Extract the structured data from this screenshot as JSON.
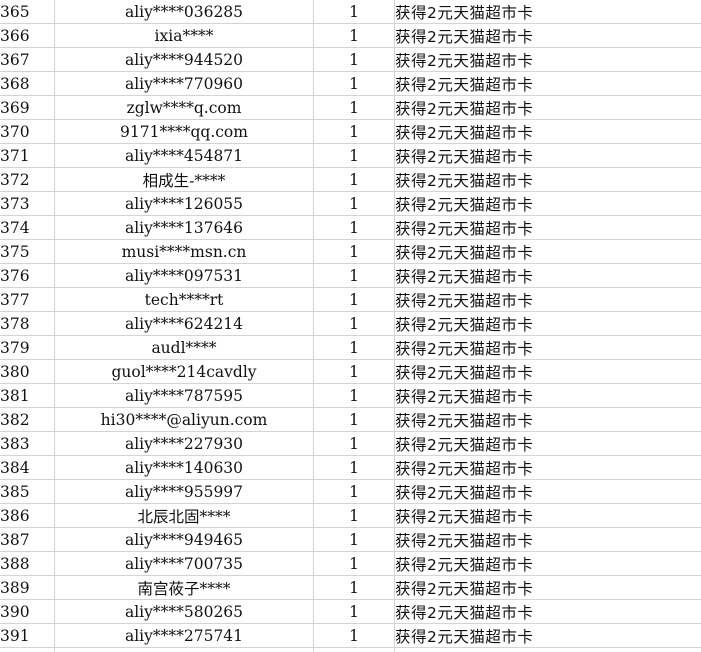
{
  "rows": [
    {
      "idx": "365",
      "user": "aliy****036285",
      "count": "1",
      "prize": "获得2元天猫超市卡"
    },
    {
      "idx": "366",
      "user": "ixia****",
      "count": "1",
      "prize": "获得2元天猫超市卡"
    },
    {
      "idx": "367",
      "user": "aliy****944520",
      "count": "1",
      "prize": "获得2元天猫超市卡"
    },
    {
      "idx": "368",
      "user": "aliy****770960",
      "count": "1",
      "prize": "获得2元天猫超市卡"
    },
    {
      "idx": "369",
      "user": "zglw****q.com",
      "count": "1",
      "prize": "获得2元天猫超市卡"
    },
    {
      "idx": "370",
      "user": "9171****qq.com",
      "count": "1",
      "prize": "获得2元天猫超市卡"
    },
    {
      "idx": "371",
      "user": "aliy****454871",
      "count": "1",
      "prize": "获得2元天猫超市卡"
    },
    {
      "idx": "372",
      "user": "相成生-****",
      "count": "1",
      "prize": "获得2元天猫超市卡"
    },
    {
      "idx": "373",
      "user": "aliy****126055",
      "count": "1",
      "prize": "获得2元天猫超市卡"
    },
    {
      "idx": "374",
      "user": "aliy****137646",
      "count": "1",
      "prize": "获得2元天猫超市卡"
    },
    {
      "idx": "375",
      "user": "musi****msn.cn",
      "count": "1",
      "prize": "获得2元天猫超市卡"
    },
    {
      "idx": "376",
      "user": "aliy****097531",
      "count": "1",
      "prize": "获得2元天猫超市卡"
    },
    {
      "idx": "377",
      "user": "tech****rt",
      "count": "1",
      "prize": "获得2元天猫超市卡"
    },
    {
      "idx": "378",
      "user": "aliy****624214",
      "count": "1",
      "prize": "获得2元天猫超市卡"
    },
    {
      "idx": "379",
      "user": "audl****",
      "count": "1",
      "prize": "获得2元天猫超市卡"
    },
    {
      "idx": "380",
      "user": "guol****214cavdly",
      "count": "1",
      "prize": "获得2元天猫超市卡"
    },
    {
      "idx": "381",
      "user": "aliy****787595",
      "count": "1",
      "prize": "获得2元天猫超市卡"
    },
    {
      "idx": "382",
      "user": "hi30****@aliyun.com",
      "count": "1",
      "prize": "获得2元天猫超市卡"
    },
    {
      "idx": "383",
      "user": "aliy****227930",
      "count": "1",
      "prize": "获得2元天猫超市卡"
    },
    {
      "idx": "384",
      "user": "aliy****140630",
      "count": "1",
      "prize": "获得2元天猫超市卡"
    },
    {
      "idx": "385",
      "user": "aliy****955997",
      "count": "1",
      "prize": "获得2元天猫超市卡"
    },
    {
      "idx": "386",
      "user": "北辰北固****",
      "count": "1",
      "prize": "获得2元天猫超市卡"
    },
    {
      "idx": "387",
      "user": "aliy****949465",
      "count": "1",
      "prize": "获得2元天猫超市卡"
    },
    {
      "idx": "388",
      "user": "aliy****700735",
      "count": "1",
      "prize": "获得2元天猫超市卡"
    },
    {
      "idx": "389",
      "user": "南宫莜子****",
      "count": "1",
      "prize": "获得2元天猫超市卡"
    },
    {
      "idx": "390",
      "user": "aliy****580265",
      "count": "1",
      "prize": "获得2元天猫超市卡"
    },
    {
      "idx": "391",
      "user": "aliy****275741",
      "count": "1",
      "prize": "获得2元天猫超市卡"
    }
  ]
}
